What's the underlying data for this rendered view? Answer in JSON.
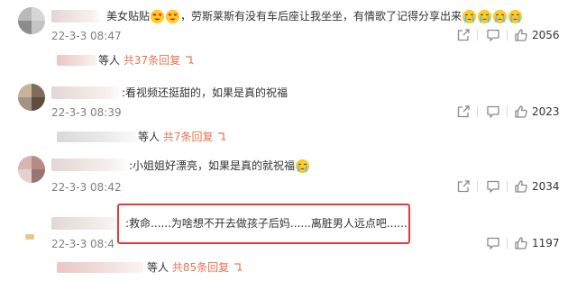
{
  "comments": [
    {
      "text_a": "美女贴贴",
      "text_b": "，劳斯莱斯有没有车后座让我坐坐，有情歌了记得分享出来",
      "emojis_a": [
        "heart-eyes",
        "heart-eyes"
      ],
      "emojis_b": [
        "crying",
        "crying",
        "crying",
        "crying"
      ],
      "date": "22-3-3 08:47",
      "likes": "2056",
      "replies_prefix": "等人",
      "replies_count": "共37条回复"
    },
    {
      "text": ":看视频还挺甜的，如果是真的祝福",
      "date": "22-3-3 08:39",
      "likes": "2023",
      "replies_prefix": "等人",
      "replies_count": "共7条回复"
    },
    {
      "text": ":小姐姐好漂亮，如果是真的就祝福",
      "emojis": [
        "crying"
      ],
      "date": "22-3-3 08:42",
      "likes": "2034"
    },
    {
      "text": ":救命......为啥想不开去做孩子后妈......离脏男人远点吧.......",
      "date": "22-3-3 08:4",
      "likes": "1197",
      "replies_prefix": "等人",
      "replies_count": "共85条回复"
    }
  ],
  "colors": {
    "reply_link": "#eb7350",
    "highlight_box": "#e33a3a",
    "date": "#808080"
  },
  "icons": [
    "share-icon",
    "comment-icon",
    "like-icon",
    "reply-arrow-icon"
  ]
}
